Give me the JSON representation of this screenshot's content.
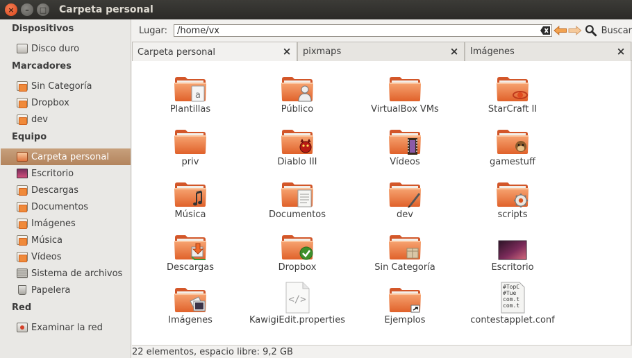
{
  "window": {
    "title": "Carpeta personal",
    "close_glyph": "×",
    "min_glyph": "–",
    "max_glyph": "□"
  },
  "sidebar": {
    "sections": [
      {
        "label": "Dispositivos",
        "items": [
          {
            "label": "Disco duro",
            "icon": "drive-icon"
          }
        ]
      },
      {
        "label": "Marcadores",
        "items": [
          {
            "label": "Sin Categoría",
            "icon": "folder-icon"
          },
          {
            "label": "Dropbox",
            "icon": "folder-icon"
          },
          {
            "label": "dev",
            "icon": "folder-icon"
          }
        ]
      },
      {
        "label": "Equipo",
        "items": [
          {
            "label": "Carpeta personal",
            "icon": "home-folder-icon",
            "selected": true
          },
          {
            "label": "Escritorio",
            "icon": "desktop-icon"
          },
          {
            "label": "Descargas",
            "icon": "folder-icon"
          },
          {
            "label": "Documentos",
            "icon": "folder-icon"
          },
          {
            "label": "Imágenes",
            "icon": "folder-icon"
          },
          {
            "label": "Música",
            "icon": "folder-icon"
          },
          {
            "label": "Vídeos",
            "icon": "folder-icon"
          },
          {
            "label": "Sistema de archivos",
            "icon": "filesystem-icon"
          },
          {
            "label": "Papelera",
            "icon": "trash-icon"
          }
        ]
      },
      {
        "label": "Red",
        "items": [
          {
            "label": "Examinar la red",
            "icon": "network-icon"
          }
        ]
      }
    ]
  },
  "location": {
    "label": "Lugar:",
    "value": "/home/vx",
    "search_label": "Buscar"
  },
  "tabs": [
    {
      "label": "Carpeta personal",
      "active": true
    },
    {
      "label": "pixmaps",
      "active": false
    },
    {
      "label": "Imágenes",
      "active": false
    }
  ],
  "tab_close_glyph": "×",
  "files": [
    {
      "label": "Plantillas",
      "icon": "templates-folder-icon"
    },
    {
      "label": "Público",
      "icon": "public-folder-icon"
    },
    {
      "label": "VirtualBox VMs",
      "icon": "folder-icon"
    },
    {
      "label": "StarCraft II",
      "icon": "starcraft-folder-icon"
    },
    {
      "label": "priv",
      "icon": "folder-icon"
    },
    {
      "label": "Diablo III",
      "icon": "diablo-folder-icon"
    },
    {
      "label": "Vídeos",
      "icon": "videos-folder-icon"
    },
    {
      "label": "gamestuff",
      "icon": "monkey-folder-icon"
    },
    {
      "label": "Música",
      "icon": "music-folder-icon"
    },
    {
      "label": "Documentos",
      "icon": "documents-folder-icon"
    },
    {
      "label": "dev",
      "icon": "dev-folder-icon"
    },
    {
      "label": "scripts",
      "icon": "gear-folder-icon"
    },
    {
      "label": "Descargas",
      "icon": "downloads-folder-icon"
    },
    {
      "label": "Dropbox",
      "icon": "dropbox-folder-icon"
    },
    {
      "label": "Sin Categoría",
      "icon": "box-folder-icon"
    },
    {
      "label": "Escritorio",
      "icon": "desktop-folder-icon"
    },
    {
      "label": "Imágenes",
      "icon": "pictures-folder-icon"
    },
    {
      "label": "KawigiEdit.properties",
      "icon": "text-file-icon"
    },
    {
      "label": "Ejemplos",
      "icon": "link-folder-icon"
    },
    {
      "label": "contestapplet.conf",
      "icon": "conf-file-icon"
    },
    {
      "label": "",
      "icon": "package-icon"
    },
    {
      "label": "",
      "icon": "package-icon"
    }
  ],
  "conf_preview": [
    "#TopC",
    "#Tue",
    "com.t",
    "com.t"
  ],
  "status": {
    "text": "22 elementos, espacio libre: 9,2 GB"
  },
  "colors": {
    "folder_orange": "#ef7b3a",
    "selection": "#b8896a",
    "titlebar": "#3c3b37"
  }
}
